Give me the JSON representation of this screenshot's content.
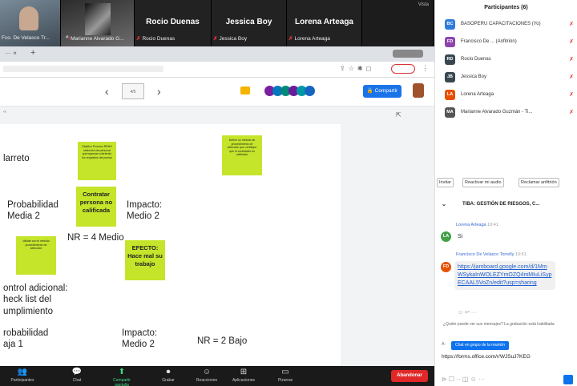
{
  "tiles": {
    "t1_name": "",
    "t1_bar": "Fco. De Velasco Tr...",
    "t2_bar": "Marianne Alvarado G...",
    "t3_name": "Rocio Duenas",
    "t3_bar": "Rocio Duenas",
    "t4_name": "Jessica Boy",
    "t4_bar": "Jessica Boy",
    "t5_name": "Lorena Arteaga",
    "t5_bar": "Lorena Arteaga",
    "vote": "Vista"
  },
  "jam": {
    "share_label": "Compartir",
    "zoom": "4/5"
  },
  "canvas": {
    "l1": "larreto",
    "l2": "Probabilidad\nMedia 2",
    "l3": "Impacto:\nMedio 2",
    "l4": "NR = 4 Medio",
    "l5": "ontrol adicional:\nheck list del\numplimiento",
    "l6": "robabilidad\naja 1",
    "l7": "Impacto:\nMedio 2",
    "l8": "NR = 2 Bajo",
    "n1": "Objetivo Proceso RRHH selección de personal que ingresan cubriendo los requisitos del puesto",
    "n2": "Contratar persona no calificada",
    "n3": "EFECTO: Hace mal su trabajo",
    "n4": "Validar con el método procedimiento de selección",
    "n5": "Definir un método de procedimiento de selección que certifique que el contratado es calificado"
  },
  "toolbar": {
    "participants": "Participantes",
    "chat": "Chat",
    "share": "Compartir pantalla",
    "record": "Grabar",
    "reactions": "Reacciones",
    "apps": "Aplicaciones",
    "whiteboards": "Pizarras",
    "end": "Abandonar"
  },
  "participants": {
    "title": "Participantes (6)",
    "list": [
      {
        "initials": "BC",
        "name": "BASOPERU CAPACITACIONES (Yo)",
        "color": "#2e7dd7"
      },
      {
        "initials": "FD",
        "name": "Francisco De ... (Anfitrión)",
        "color": "#8e44ad"
      },
      {
        "initials": "RD",
        "name": "Rocio Duenas",
        "color": "#37474f"
      },
      {
        "initials": "JB",
        "name": "Jessica Boy",
        "color": "#37474f"
      },
      {
        "initials": "LA",
        "name": "Lorena Arteaga",
        "color": "#e65100"
      },
      {
        "initials": "MA",
        "name": "Marianne Alvarado Guzmán - Ti...",
        "color": "#555"
      }
    ],
    "btn_invite": "Invitar",
    "btn_unmute": "Reactivar mi audio",
    "btn_claim": "Reclamar anfitrión"
  },
  "chat": {
    "title": "TIBA: GESTIÓN DE RIESGOS, C...",
    "m1_from": "Lorena Arteaga",
    "m1_time": "10:41",
    "m1_text": "Si",
    "m2_from": "Francisco De Velasco Torrelly",
    "m2_time": "10:51",
    "m2_link": "https://jamboard.google.com/d/1MmWSykaInWOLEZYmOZQ4mMIuLiSypECAAL5VoZn/edit?usp=sharing",
    "who": "¿Quién puede ver sus mensajes? La grabación está habilitada",
    "to_label": "Chat en grupo de la reunión",
    "input_text": "https://forms.office.com/r/WJSuJ7KEG"
  }
}
